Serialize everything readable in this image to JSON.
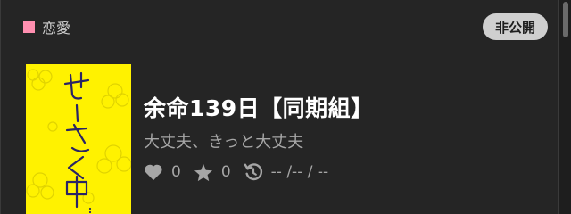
{
  "card": {
    "genre": {
      "label": "恋愛",
      "color": "#ff8fb0"
    },
    "visibility_badge": "非公開",
    "cover": {
      "text_main": "せーさく中",
      "text_dots": "…",
      "background": "#fff200"
    },
    "title": "余命139日【同期組】",
    "subtitle": "大丈夫、きっと大丈夫",
    "stats": {
      "likes": "0",
      "stars": "0",
      "updated": "-- /-- / --"
    }
  },
  "icons": [
    "heart-icon",
    "star-icon",
    "refresh-clock-icon"
  ]
}
